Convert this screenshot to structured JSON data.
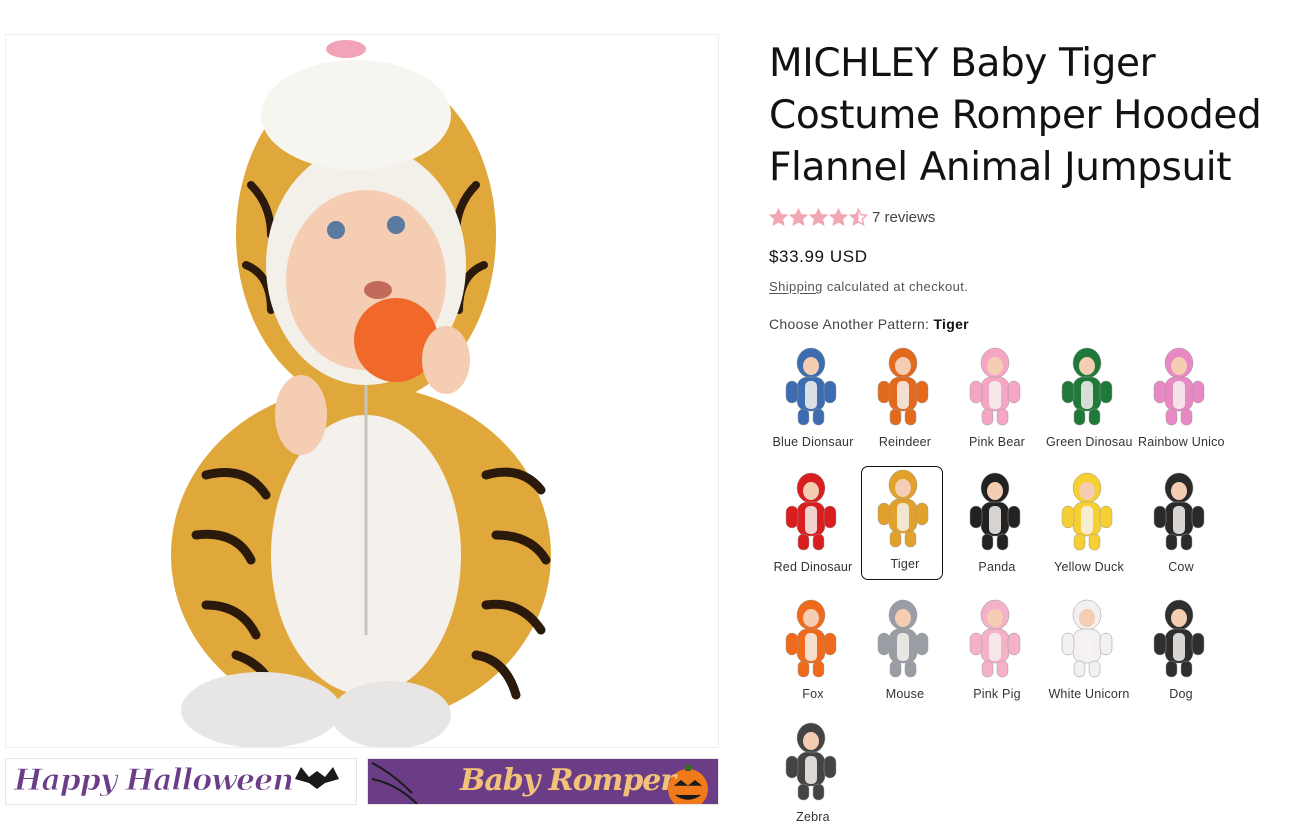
{
  "product": {
    "title": "MICHLEY Baby Tiger Costume Romper Hooded Flannel Animal Jumpsuit",
    "rating": 4.5,
    "reviews_label": "7 reviews",
    "price": "$33.99 USD",
    "shipping_link": "Shipping",
    "shipping_suffix": "calculated at checkout.",
    "pattern_prefix": "Choose Another Pattern:",
    "pattern_selected": "Tiger"
  },
  "thumbnails": [
    {
      "text": "Happy Halloween"
    },
    {
      "text": "Baby Romper"
    }
  ],
  "patterns": [
    {
      "label": "Blue Dionsaur",
      "color": "#3d6db0"
    },
    {
      "label": "Reindeer",
      "color": "#e36a1c"
    },
    {
      "label": "Pink Bear",
      "color": "#f4a6c4"
    },
    {
      "label": "Green Dinosaur",
      "color": "#1f7a3a"
    },
    {
      "label": "Rainbow Unicorn",
      "color": "#e889c6"
    },
    {
      "label": "Red Dinosaur",
      "color": "#d81e1e"
    },
    {
      "label": "Tiger",
      "color": "#e2a12a"
    },
    {
      "label": "Panda",
      "color": "#222222"
    },
    {
      "label": "Yellow Duck",
      "color": "#f6cf33"
    },
    {
      "label": "Cow",
      "color": "#2a2a2a"
    },
    {
      "label": "Fox",
      "color": "#ef6a1a"
    },
    {
      "label": "Mouse",
      "color": "#9a9ea4"
    },
    {
      "label": "Pink Pig",
      "color": "#f4b1c8"
    },
    {
      "label": "White Unicorn",
      "color": "#f2f0f0"
    },
    {
      "label": "Dog",
      "color": "#2f2f2f"
    },
    {
      "label": "Zebra",
      "color": "#444444"
    }
  ],
  "colors": {
    "star": "#f1a7b4",
    "accent": "#121212"
  }
}
